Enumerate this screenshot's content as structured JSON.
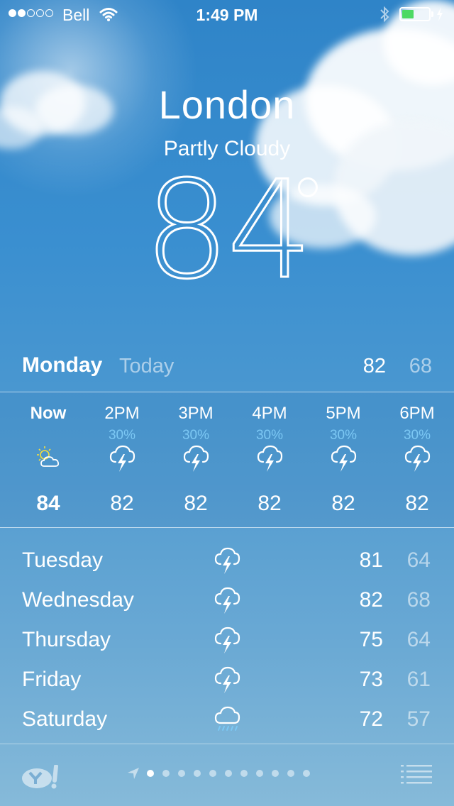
{
  "status_bar": {
    "carrier": "Bell",
    "time": "1:49 PM",
    "signal_dots_filled": 2,
    "signal_dots_total": 5,
    "battery_fraction": 0.45,
    "battery_color": "#4cd964"
  },
  "location": {
    "city": "London",
    "condition": "Partly Cloudy",
    "temperature": "84"
  },
  "today": {
    "day": "Monday",
    "label": "Today",
    "high": "82",
    "low": "68"
  },
  "hourly": [
    {
      "time": "Now",
      "precip": "",
      "icon": "partly-cloudy-icon",
      "temp": "84"
    },
    {
      "time": "2PM",
      "precip": "30%",
      "icon": "thunderstorm-icon",
      "temp": "82"
    },
    {
      "time": "3PM",
      "precip": "30%",
      "icon": "thunderstorm-icon",
      "temp": "82"
    },
    {
      "time": "4PM",
      "precip": "30%",
      "icon": "thunderstorm-icon",
      "temp": "82"
    },
    {
      "time": "5PM",
      "precip": "30%",
      "icon": "thunderstorm-icon",
      "temp": "82"
    },
    {
      "time": "6PM",
      "precip": "30%",
      "icon": "thunderstorm-icon",
      "temp": "82"
    }
  ],
  "forecast": [
    {
      "day": "Tuesday",
      "icon": "thunderstorm-icon",
      "high": "81",
      "low": "64"
    },
    {
      "day": "Wednesday",
      "icon": "thunderstorm-icon",
      "high": "82",
      "low": "68"
    },
    {
      "day": "Thursday",
      "icon": "thunderstorm-icon",
      "high": "75",
      "low": "64"
    },
    {
      "day": "Friday",
      "icon": "thunderstorm-icon",
      "high": "73",
      "low": "61"
    },
    {
      "day": "Saturday",
      "icon": "rain-icon",
      "high": "72",
      "low": "57"
    }
  ],
  "bottom_bar": {
    "page_count": 11,
    "active_page": 1
  }
}
